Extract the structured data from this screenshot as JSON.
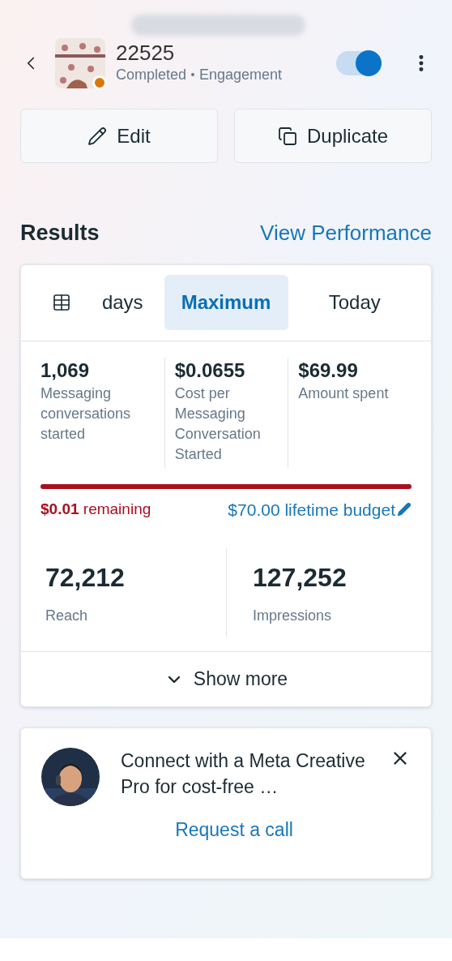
{
  "header": {
    "title": "22525",
    "status": "Completed",
    "objective": "Engagement",
    "toggle": {
      "on": true
    }
  },
  "actions": [
    {
      "label": "Edit",
      "kind": "edit"
    },
    {
      "label": "Duplicate",
      "kind": "duplicate"
    }
  ],
  "results": {
    "title": "Results",
    "link": "View Performance",
    "tabs": [
      {
        "label": "days",
        "kind": "calendar",
        "selected": false
      },
      {
        "label": "Maximum",
        "selected": true
      },
      {
        "label": "Today",
        "selected": false
      }
    ],
    "metrics": [
      {
        "value": "1,069",
        "label": "Messaging conversations started"
      },
      {
        "value": "$0.0655",
        "label": "Cost per Messaging Conversation Started"
      },
      {
        "value": "$69.99",
        "label": "Amount spent"
      }
    ],
    "budget": {
      "level": 1,
      "remaining_amount": "$0.01",
      "remaining_text": "remaining",
      "lifetime": "$70.00 lifetime budget"
    },
    "stats": [
      {
        "value": "72,212",
        "label": "Reach"
      },
      {
        "value": "127,252",
        "label": "Impressions"
      }
    ],
    "show_more": "Show more"
  },
  "promo": {
    "text": "Connect with a Meta Creative Pro for cost-free …",
    "action": "Request a call"
  }
}
